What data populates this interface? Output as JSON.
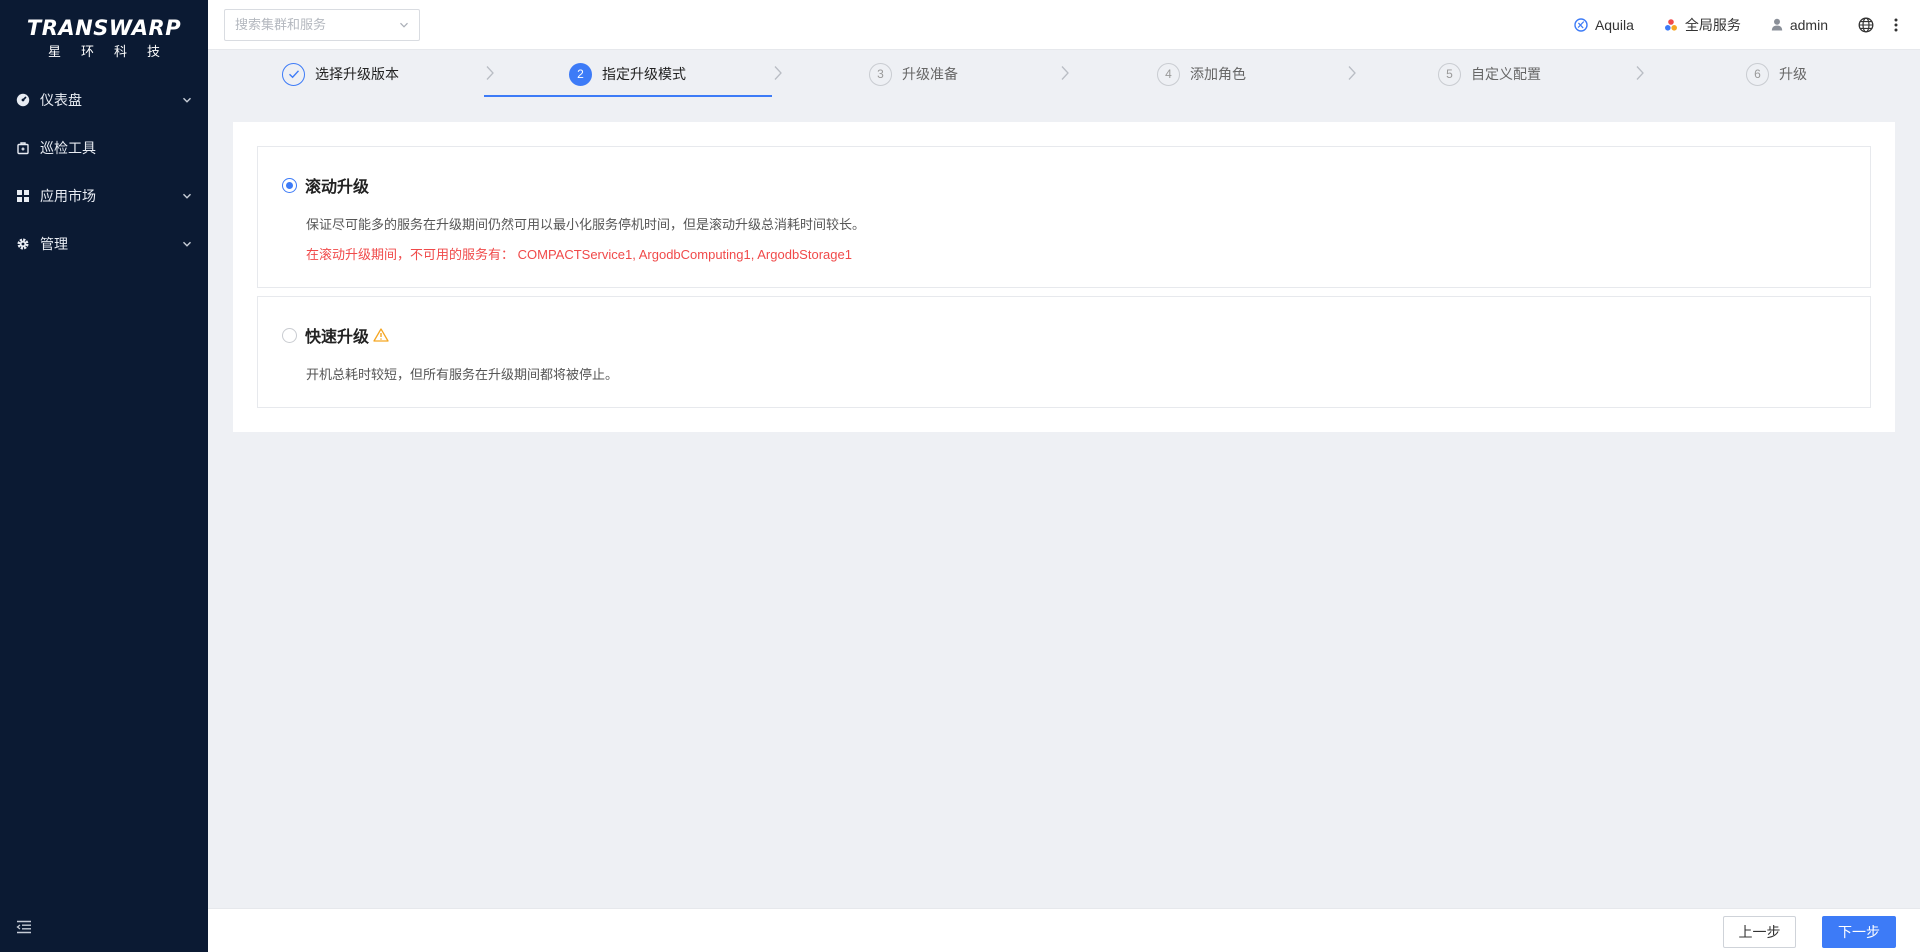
{
  "logo": {
    "main": "TRANSWARP",
    "sub": "星环科技"
  },
  "sidebar": {
    "items": [
      {
        "label": "仪表盘",
        "icon": "dashboard-icon",
        "expandable": true
      },
      {
        "label": "巡检工具",
        "icon": "inspection-icon",
        "expandable": false
      },
      {
        "label": "应用市场",
        "icon": "grid-icon",
        "expandable": true
      },
      {
        "label": "管理",
        "icon": "gear-icon",
        "expandable": true
      }
    ]
  },
  "topbar": {
    "search_placeholder": "搜索集群和服务",
    "cluster_label": "Aquila",
    "global_services_label": "全局服务",
    "user_label": "admin"
  },
  "steps": [
    {
      "number": "1",
      "label": "选择升级版本",
      "state": "done"
    },
    {
      "number": "2",
      "label": "指定升级模式",
      "state": "active"
    },
    {
      "number": "3",
      "label": "升级准备",
      "state": "pending"
    },
    {
      "number": "4",
      "label": "添加角色",
      "state": "pending"
    },
    {
      "number": "5",
      "label": "自定义配置",
      "state": "pending"
    },
    {
      "number": "6",
      "label": "升级",
      "state": "pending"
    }
  ],
  "options": {
    "rolling": {
      "title": "滚动升级",
      "selected": true,
      "description": "保证尽可能多的服务在升级期间仍然可用以最小化服务停机时间，但是滚动升级总消耗时间较长。",
      "warning": "在滚动升级期间，不可用的服务有： COMPACTService1, ArgodbComputing1, ArgodbStorage1"
    },
    "fast": {
      "title": "快速升级",
      "selected": false,
      "description": "开机总耗时较短，但所有服务在升级期间都将被停止。"
    }
  },
  "footer": {
    "prev_label": "上一步",
    "next_label": "下一步"
  },
  "colors": {
    "primary": "#3d7bf7",
    "sidebar_bg": "#0b1a33",
    "warning_text": "#f04a4a",
    "warning_icon": "#f5a623"
  }
}
